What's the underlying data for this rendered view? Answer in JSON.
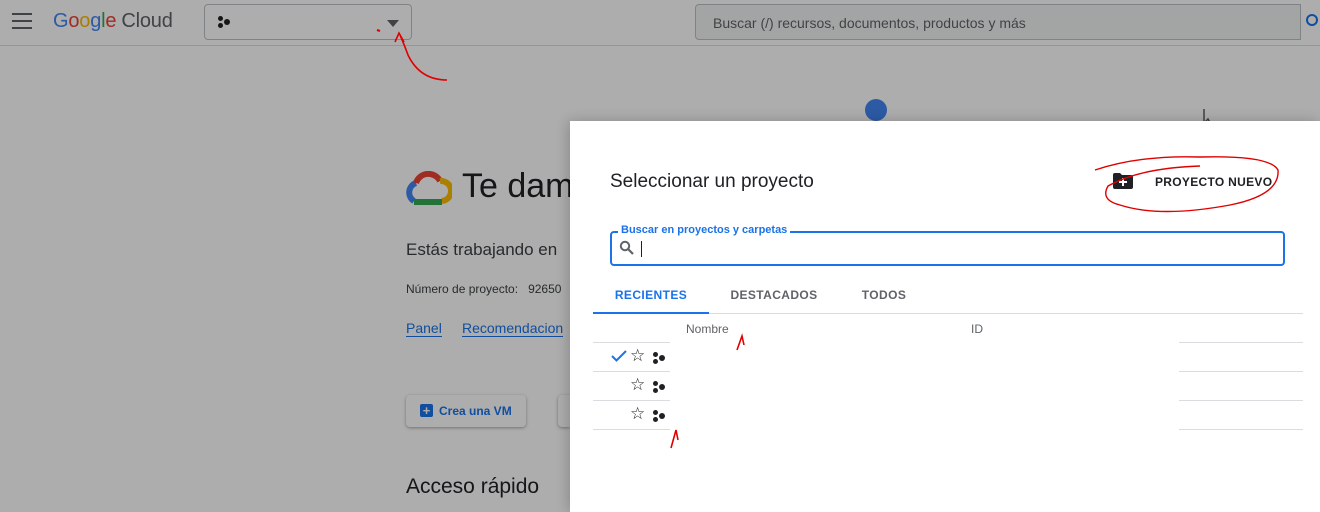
{
  "topbar": {
    "brand": {
      "g": "G",
      "o1": "o",
      "o2": "o",
      "g2": "g",
      "l": "l",
      "e": "e",
      "product": "Cloud"
    },
    "project_picker": {
      "name": ""
    },
    "search": {
      "placeholder": "Buscar (/) recursos, documentos, productos y más"
    }
  },
  "page": {
    "welcome_title": "Te dam",
    "working_text": "Estás trabajando en",
    "project_number_label": "Número de proyecto:",
    "project_number_value": "92650",
    "links": [
      "Panel",
      "Recomendacion"
    ],
    "create_vm": "Crea una VM",
    "quick_access": "Acceso rápido"
  },
  "dialog": {
    "title": "Seleccionar un proyecto",
    "new_project": "PROYECTO NUEVO",
    "search_label": "Buscar en proyectos y carpetas",
    "search_value": "",
    "tabs": [
      {
        "label": "RECIENTES",
        "active": true
      },
      {
        "label": "DESTACADOS",
        "active": false
      },
      {
        "label": "TODOS",
        "active": false
      }
    ],
    "columns": {
      "name": "Nombre",
      "id": "ID"
    },
    "rows": [
      {
        "selected": true,
        "star": "☆",
        "name": "",
        "id": ""
      },
      {
        "selected": false,
        "star": "☆",
        "name": "",
        "id": ""
      },
      {
        "selected": false,
        "star": "☆",
        "name": "",
        "id": ""
      }
    ]
  },
  "colors": {
    "accent": "#1a73e8",
    "annotation": "#e00000",
    "overlay": "rgba(0,0,0,0.32)"
  }
}
